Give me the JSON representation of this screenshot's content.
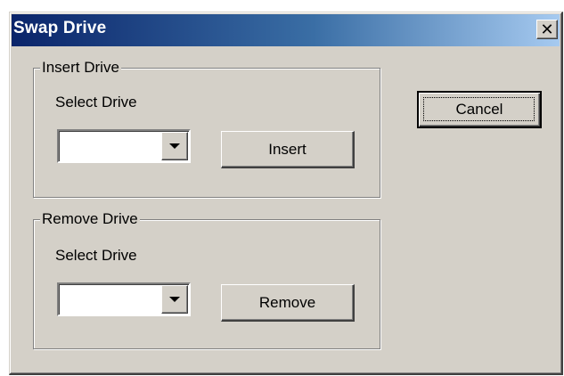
{
  "window": {
    "title": "Swap Drive",
    "close_glyph": "✕",
    "close_icon": "close-icon"
  },
  "insert_group": {
    "legend": "Insert Drive",
    "select_label": "Select Drive",
    "combo_value": "",
    "button_label": "Insert"
  },
  "remove_group": {
    "legend": "Remove Drive",
    "select_label": "Select Drive",
    "combo_value": "",
    "button_label": "Remove"
  },
  "actions": {
    "cancel_label": "Cancel"
  },
  "colors": {
    "title_gradient_start": "#0a246a",
    "title_gradient_end": "#a6caf0",
    "face": "#d4d0c8",
    "title_text": "#ffffff"
  }
}
